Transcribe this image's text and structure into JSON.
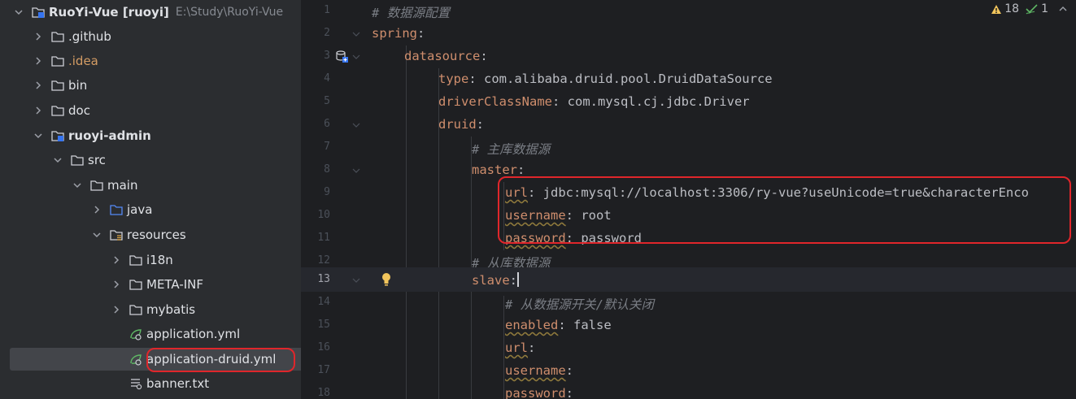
{
  "project_tree": {
    "items": [
      {
        "label": "RuoYi-Vue [ruoyi]",
        "path": "E:\\Study\\RuoYi-Vue",
        "icon": "module-folder-icon",
        "expanded": true
      },
      {
        "label": ".github",
        "icon": "folder-icon",
        "expanded": false
      },
      {
        "label": ".idea",
        "icon": "folder-icon",
        "expanded": false
      },
      {
        "label": "bin",
        "icon": "folder-icon",
        "expanded": false
      },
      {
        "label": "doc",
        "icon": "folder-icon",
        "expanded": false
      },
      {
        "label": "ruoyi-admin",
        "icon": "module-folder-icon",
        "expanded": true
      },
      {
        "label": "src",
        "icon": "folder-icon",
        "expanded": true
      },
      {
        "label": "main",
        "icon": "folder-icon",
        "expanded": true
      },
      {
        "label": "java",
        "icon": "source-folder-icon",
        "expanded": false
      },
      {
        "label": "resources",
        "icon": "resources-folder-icon",
        "expanded": true
      },
      {
        "label": "i18n",
        "icon": "folder-icon",
        "expanded": false
      },
      {
        "label": "META-INF",
        "icon": "folder-icon",
        "expanded": false
      },
      {
        "label": "mybatis",
        "icon": "folder-icon",
        "expanded": false
      },
      {
        "label": "application.yml",
        "icon": "spring-yaml-icon"
      },
      {
        "label": "application-druid.yml",
        "icon": "spring-yaml-icon",
        "selected": true
      },
      {
        "label": "banner.txt",
        "icon": "text-file-icon"
      }
    ]
  },
  "editor": {
    "inspections": {
      "warnings": "18",
      "typos": "1"
    },
    "current_line": "13",
    "lines": [
      {
        "n": "1",
        "comment": "# 数据源配置"
      },
      {
        "n": "2",
        "key": "spring",
        "sep": ":"
      },
      {
        "n": "3",
        "key": "datasource",
        "sep": ":"
      },
      {
        "n": "4",
        "key": "type",
        "sep": ": ",
        "value": "com.alibaba.druid.pool.DruidDataSource"
      },
      {
        "n": "5",
        "key": "driverClassName",
        "sep": ": ",
        "value": "com.mysql.cj.jdbc.Driver"
      },
      {
        "n": "6",
        "key": "druid",
        "sep": ":"
      },
      {
        "n": "7",
        "comment": "# 主库数据源"
      },
      {
        "n": "8",
        "key": "master",
        "sep": ":"
      },
      {
        "n": "9",
        "key": "url",
        "sep": ": ",
        "value": "jdbc:mysql://localhost:3306/ry-vue?useUnicode=true&characterEnco"
      },
      {
        "n": "10",
        "key": "username",
        "sep": ": ",
        "value": "root"
      },
      {
        "n": "11",
        "key": "password",
        "sep": ": ",
        "value": "password"
      },
      {
        "n": "12",
        "comment": "# 从库数据源"
      },
      {
        "n": "13",
        "key": "slave",
        "sep": ":"
      },
      {
        "n": "14",
        "comment": "# 从数据源开关/默认关闭"
      },
      {
        "n": "15",
        "key": "enabled",
        "sep": ": ",
        "value": "false"
      },
      {
        "n": "16",
        "key": "url",
        "sep": ":"
      },
      {
        "n": "17",
        "key": "username",
        "sep": ":"
      },
      {
        "n": "18",
        "key": "password",
        "sep": ":"
      }
    ]
  },
  "colors": {
    "highlight_box": "#e0262b",
    "key": "#cf8e6d",
    "comment": "#7a7e85",
    "warning": "#f2c55c",
    "typo": "#5fb865"
  }
}
